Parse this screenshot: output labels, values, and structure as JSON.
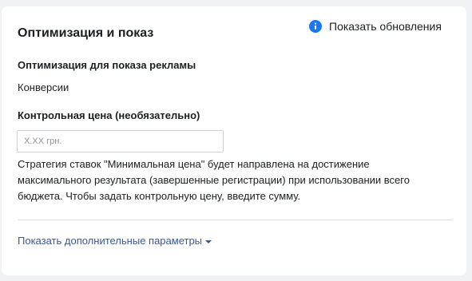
{
  "card": {
    "title": "Оптимизация и показ",
    "updates_link": "Показать обновления",
    "updates_icon": "info-icon",
    "accent_color": "#1877f2"
  },
  "optimization": {
    "label": "Оптимизация для показа рекламы",
    "value": "Конверсии"
  },
  "bid_control": {
    "label": "Контрольная цена (необязательно)",
    "placeholder": "X.XX грн.",
    "value": "",
    "help_text": "Стратегия ставок \"Минимальная цена\" будет направлена на достижение максимального результата (завершенные регистрации) при использовании всего бюджета. Чтобы задать контрольную цену, введите сумму."
  },
  "footer": {
    "more_options_link": "Показать дополнительные параметры",
    "more_options_icon": "caret-down-icon",
    "link_color": "#385898"
  }
}
